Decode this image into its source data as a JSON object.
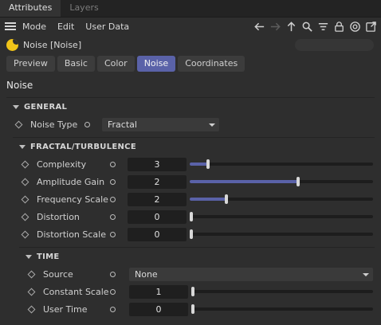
{
  "tabs": [
    {
      "label": "Attributes",
      "active": true
    },
    {
      "label": "Layers",
      "active": false
    }
  ],
  "menu": [
    "Mode",
    "Edit",
    "User Data"
  ],
  "toolbar_icons": [
    "arrow-left-icon",
    "arrow-right-icon",
    "arrow-up-icon",
    "search-icon",
    "filter-icon",
    "lock-icon",
    "target-icon",
    "new-window-icon"
  ],
  "object": {
    "name": "Noise [Noise]",
    "icon": "noise-shader-icon"
  },
  "page_tabs": [
    {
      "label": "Preview",
      "active": false
    },
    {
      "label": "Basic",
      "active": false
    },
    {
      "label": "Color",
      "active": false
    },
    {
      "label": "Noise",
      "active": true
    },
    {
      "label": "Coordinates",
      "active": false
    }
  ],
  "section_title": "Noise",
  "general": {
    "title": "GENERAL",
    "noise_type": {
      "label": "Noise Type",
      "value": "Fractal"
    }
  },
  "fractal": {
    "title": "FRACTAL/TURBULENCE",
    "params": [
      {
        "label": "Complexity",
        "value": "3",
        "slider": 0.1
      },
      {
        "label": "Amplitude Gain",
        "value": "2",
        "slider": 0.59
      },
      {
        "label": "Frequency Scale",
        "value": "2",
        "slider": 0.2
      },
      {
        "label": "Distortion",
        "value": "0",
        "slider": 0.0
      },
      {
        "label": "Distortion Scale",
        "value": "0",
        "slider": 0.0
      }
    ]
  },
  "time": {
    "title": "TIME",
    "source": {
      "label": "Source",
      "value": "None"
    },
    "params": [
      {
        "label": "Constant Scale",
        "value": "1",
        "slider": 0.0
      },
      {
        "label": "User Time",
        "value": "0",
        "slider": 0.0
      }
    ]
  },
  "colors": {
    "accent": "#5a62a8",
    "object_icon": "#f0c419"
  }
}
